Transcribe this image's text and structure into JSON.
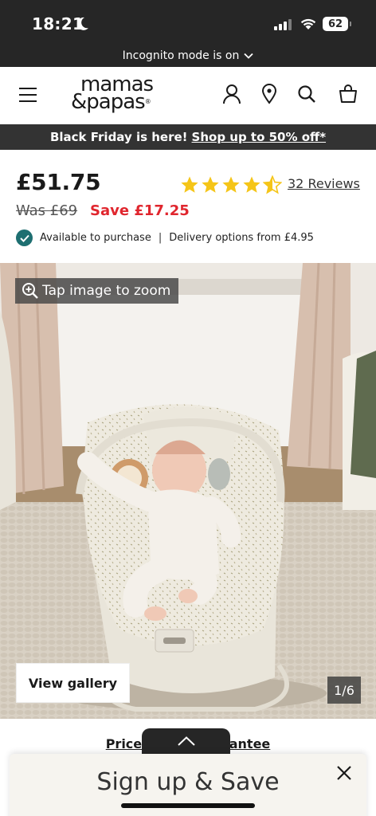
{
  "status_bar": {
    "time": "18:21",
    "battery": "62",
    "incognito_label": "Incognito mode is on"
  },
  "header": {
    "logo_line1": "mamas",
    "logo_line2": "&papas",
    "logo_reg": "®"
  },
  "promo": {
    "text": "Black Friday is here!",
    "link": "Shop up to 50% off*"
  },
  "product": {
    "price": "£51.75",
    "was_price": "Was £69",
    "save": "Save £17.25",
    "rating": 4.5,
    "reviews_label": "32 Reviews",
    "availability": "Available to purchase",
    "delivery": "Delivery options from £4.95"
  },
  "gallery": {
    "zoom_label": "Tap image to zoom",
    "view_gallery_label": "View gallery",
    "counter": "1/6"
  },
  "footer": {
    "price_guarantee": "Price Match Guarantee",
    "signup_title": "Sign up & Save"
  },
  "colors": {
    "dark": "#262626",
    "promo_bg": "#333333",
    "save_red": "#e0262e",
    "star_yellow": "#f5c518",
    "check_teal": "#1e6f71"
  }
}
